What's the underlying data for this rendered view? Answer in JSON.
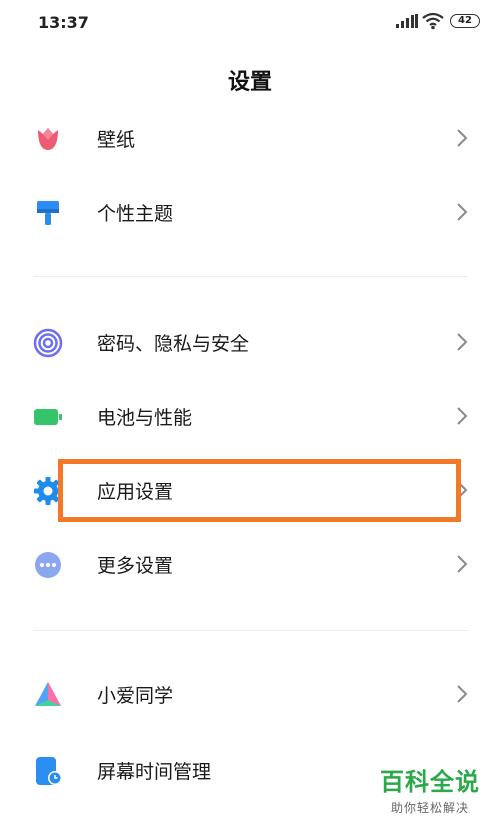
{
  "status": {
    "time": "13:37",
    "battery": "42"
  },
  "header": {
    "title": "设置"
  },
  "groups": [
    {
      "items": [
        {
          "label": "壁纸",
          "icon": "tulip-icon"
        },
        {
          "label": "个性主题",
          "icon": "paintbrush-icon"
        }
      ]
    },
    {
      "items": [
        {
          "label": "密码、隐私与安全",
          "icon": "fingerprint-icon"
        },
        {
          "label": "电池与性能",
          "icon": "battery-icon"
        },
        {
          "label": "应用设置",
          "icon": "gear-icon"
        },
        {
          "label": "更多设置",
          "icon": "more-dots-icon"
        }
      ]
    },
    {
      "items": [
        {
          "label": "小爱同学",
          "icon": "xiaoai-icon"
        },
        {
          "label": "屏幕时间管理",
          "icon": "screen-time-icon"
        }
      ]
    }
  ],
  "watermark": {
    "title": "百科全说",
    "subtitle": "助你轻松解决"
  },
  "colors": {
    "highlight": "#f07a28",
    "watermark": "#2aa84a"
  }
}
